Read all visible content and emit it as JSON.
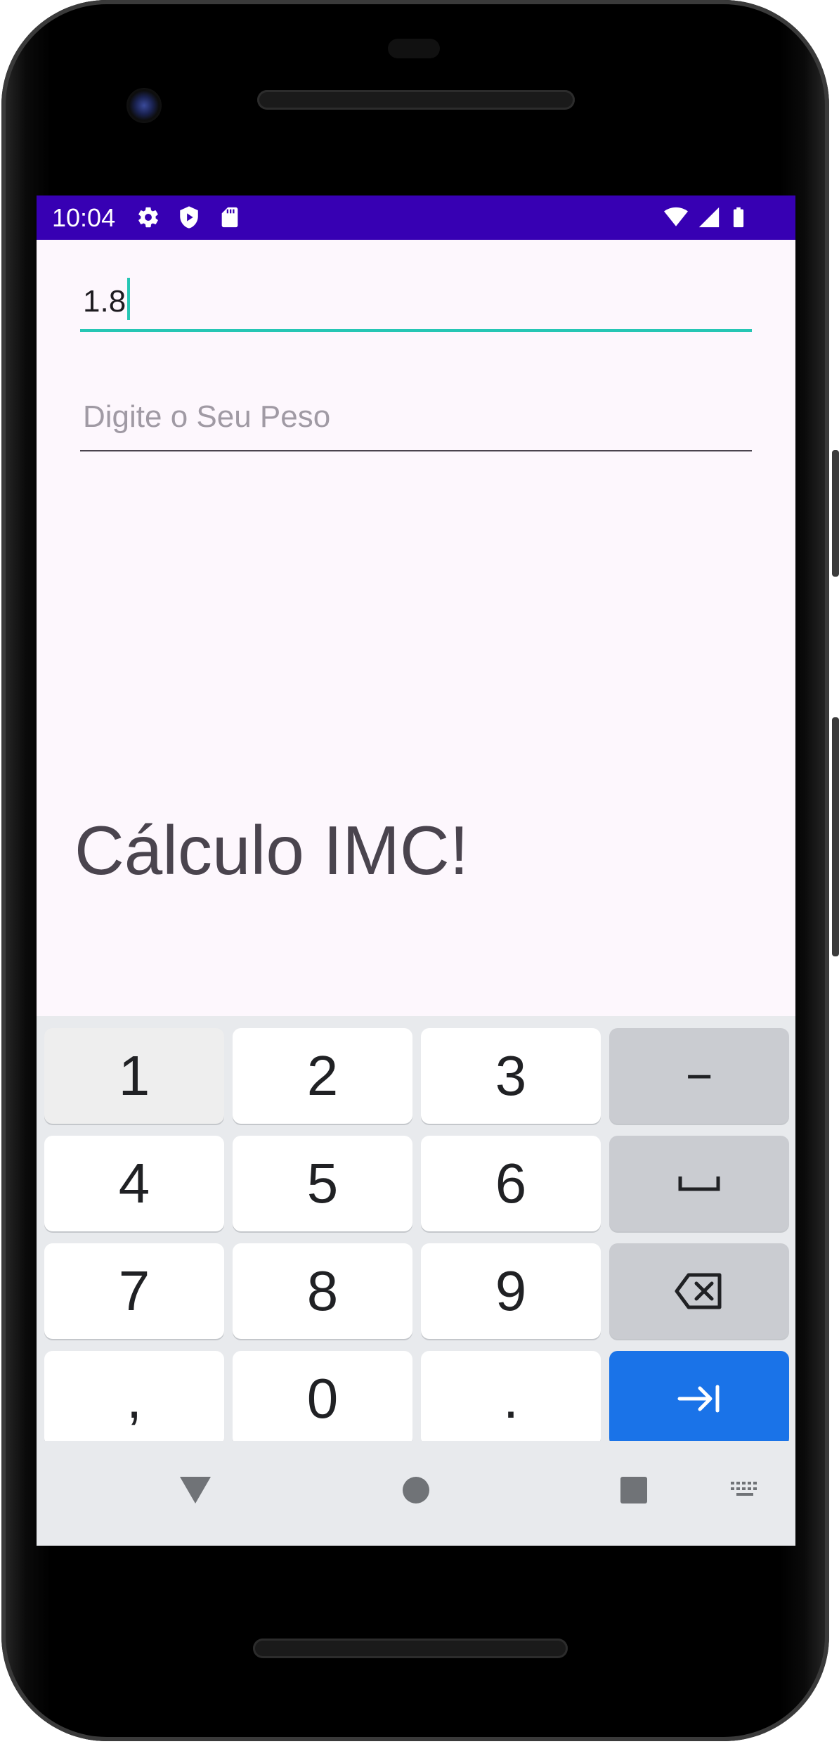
{
  "status_bar": {
    "time": "10:04",
    "icons_left": [
      "settings-icon",
      "shield-play-icon",
      "sd-card-icon"
    ],
    "icons_right": [
      "wifi-icon",
      "cell-signal-icon",
      "battery-icon"
    ],
    "background_color": "#3700b3"
  },
  "form": {
    "height_value": "1.8",
    "weight_placeholder": "Digite o Seu Peso",
    "accent_color": "#26c6b4"
  },
  "title": "Cálculo IMC!",
  "keyboard": {
    "rows": [
      [
        {
          "label": "1",
          "type": "digit",
          "pressed": true
        },
        {
          "label": "2",
          "type": "digit"
        },
        {
          "label": "3",
          "type": "digit"
        },
        {
          "label": "−",
          "type": "fn",
          "icon": "minus-icon"
        }
      ],
      [
        {
          "label": "4",
          "type": "digit"
        },
        {
          "label": "5",
          "type": "digit"
        },
        {
          "label": "6",
          "type": "digit"
        },
        {
          "label": "",
          "type": "fn",
          "icon": "space-icon"
        }
      ],
      [
        {
          "label": "7",
          "type": "digit"
        },
        {
          "label": "8",
          "type": "digit"
        },
        {
          "label": "9",
          "type": "digit"
        },
        {
          "label": "",
          "type": "fn",
          "icon": "backspace-icon"
        }
      ],
      [
        {
          "label": ",",
          "type": "digit"
        },
        {
          "label": "0",
          "type": "digit"
        },
        {
          "label": ".",
          "type": "digit"
        },
        {
          "label": "",
          "type": "action",
          "icon": "next-tab-icon"
        }
      ]
    ],
    "action_color": "#1a73e8"
  },
  "nav_bar": {
    "buttons": [
      "back-icon",
      "home-icon",
      "recents-icon",
      "keyboard-switch-icon"
    ]
  }
}
